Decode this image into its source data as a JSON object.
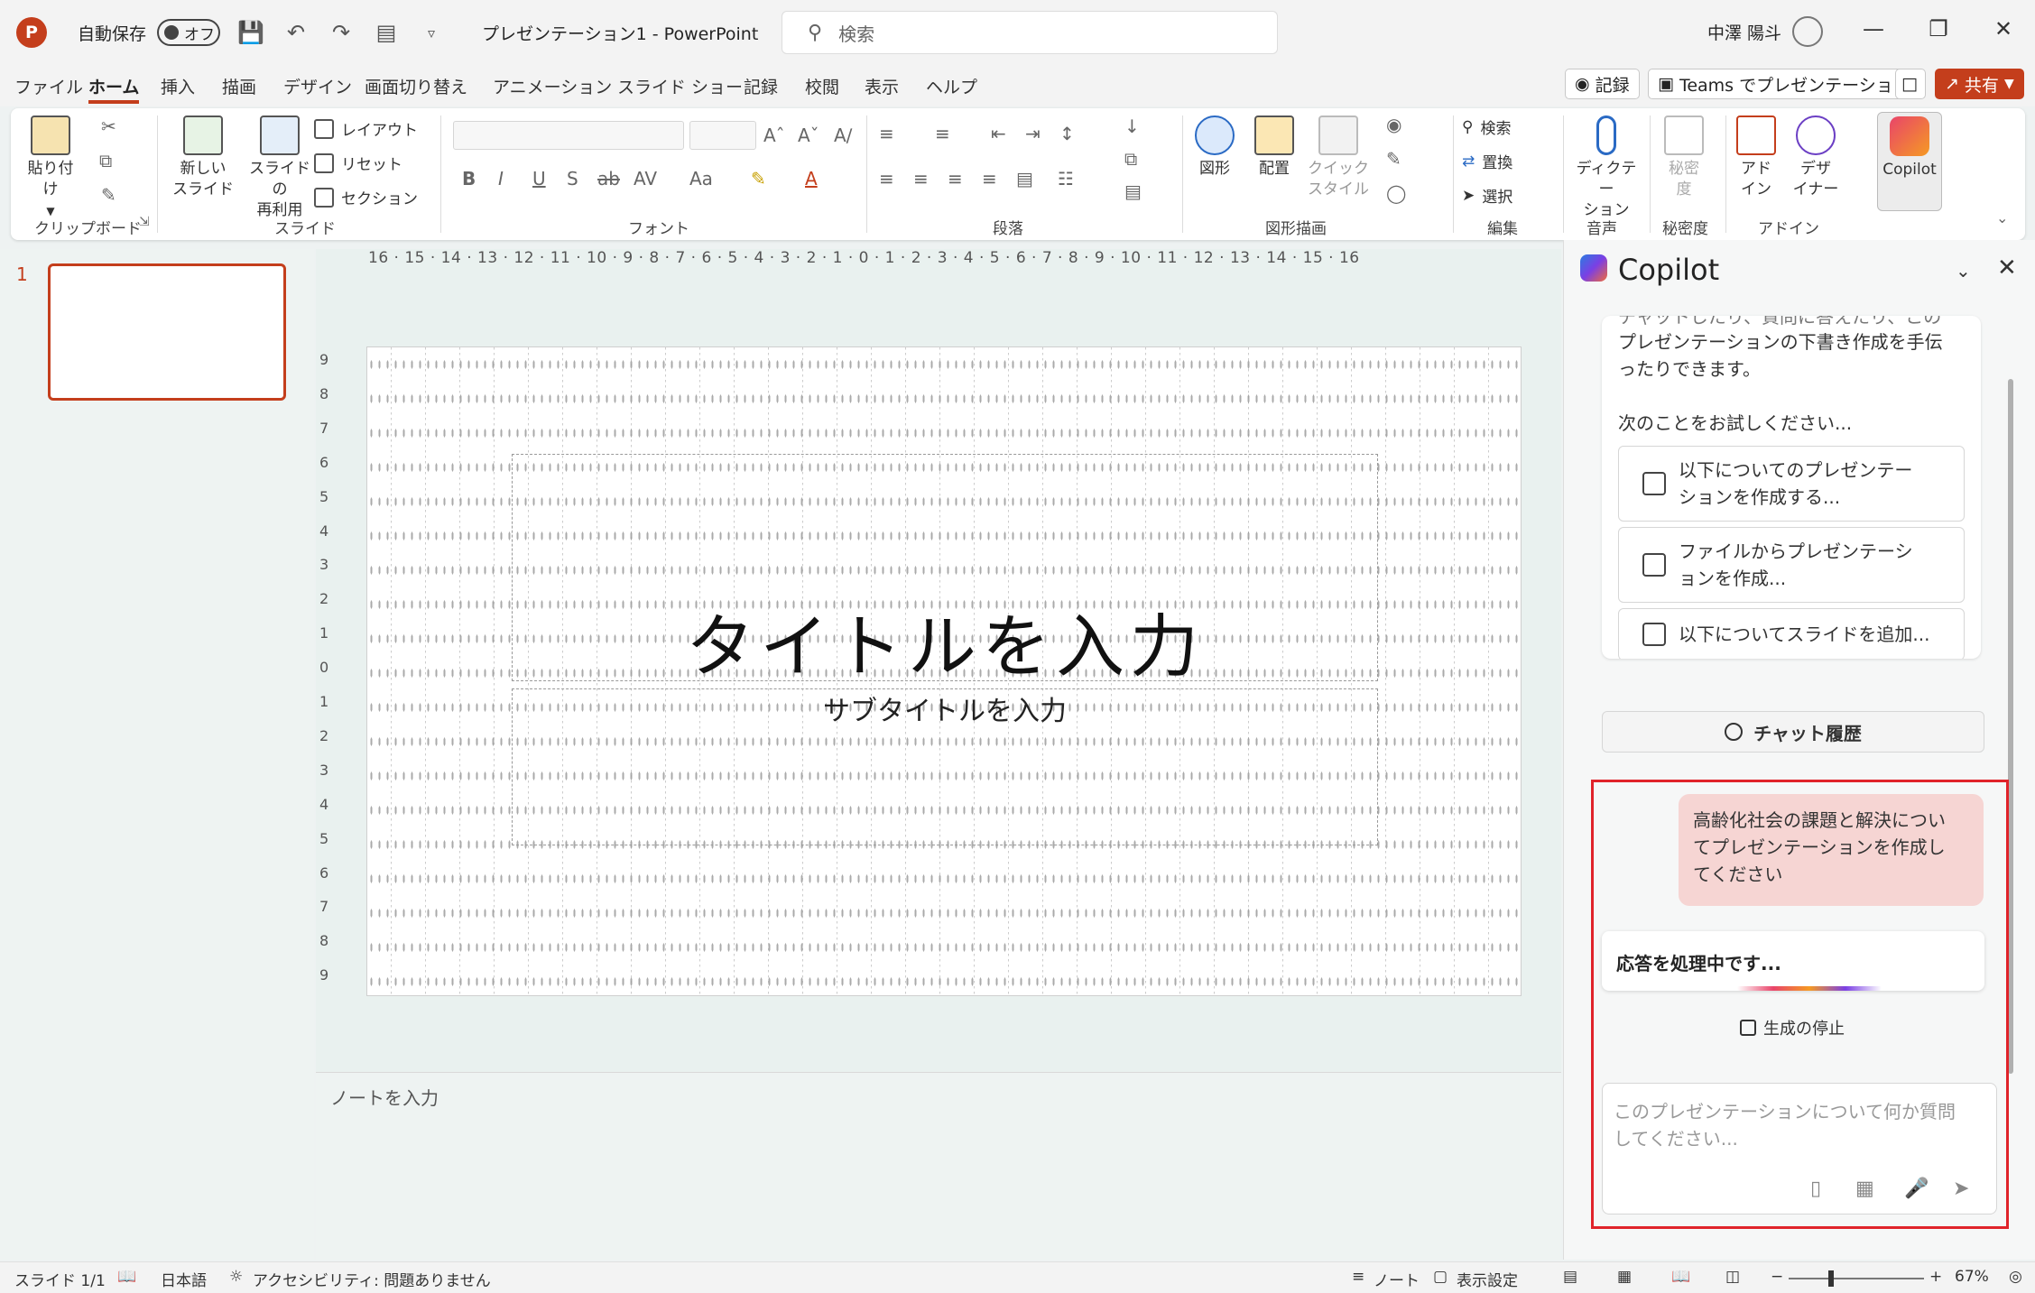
{
  "titlebar": {
    "logo": "P",
    "autosave_label": "自動保存",
    "autosave_state": "オフ",
    "doc_title": "プレゼンテーション1  -  PowerPoint",
    "search_placeholder": "検索",
    "user_name": "中澤 陽斗",
    "icons": [
      "powerpoint-logo-icon",
      "save-icon",
      "undo-icon",
      "redo-icon",
      "present-icon",
      "customize-icon",
      "search-icon",
      "avatar",
      "minimize-icon",
      "restore-icon",
      "close-icon"
    ]
  },
  "menu": {
    "items": [
      "ファイル",
      "ホーム",
      "挿入",
      "描画",
      "デザイン",
      "画面切り替え",
      "アニメーション",
      "スライド ショー",
      "記録",
      "校閲",
      "表示",
      "ヘルプ"
    ],
    "active": "ホーム",
    "record_label": "記録",
    "teams_label": "Teams でプレゼンテーション",
    "share_label": "共有"
  },
  "ribbon": {
    "paste": "貼り付け",
    "new_slide_1": "新しい",
    "new_slide_2": "スライド",
    "reuse_1": "スライドの",
    "reuse_2": "再利用",
    "layout": "レイアウト",
    "reset": "リセット",
    "section": "セクション",
    "shapes": "図形",
    "arrange": "配置",
    "quick_style_1": "クイック",
    "quick_style_2": "スタイル",
    "find": "検索",
    "replace": "置換",
    "select": "選択",
    "dictate_1": "ディクテー",
    "dictate_2": "ション",
    "sensitivity_1": "秘密",
    "sensitivity_2": "度",
    "addins_1": "アド",
    "addins_2": "イン",
    "designer_1": "デザ",
    "designer_2": "イナー",
    "copilot": "Copilot",
    "groups": {
      "clipboard": "クリップボード",
      "slides": "スライド",
      "font": "フォント",
      "paragraph": "段落",
      "drawing": "図形描画",
      "editing": "編集",
      "voice": "音声",
      "sensitivity": "秘密度",
      "addins": "アドイン"
    }
  },
  "thumbs": {
    "number": "1"
  },
  "ruler": {
    "horizontal": "16 · 15 · 14 · 13 · 12 · 11 · 10 · 9 · 8 · 7 · 6 · 5 · 4 · 3 · 2 · 1 · 0 · 1 · 2 · 3 · 4 · 5 · 6 · 7 · 8 · 9 · 10 · 11 · 12 · 13 · 14 · 15 · 16",
    "vertical": [
      "9",
      "8",
      "7",
      "6",
      "5",
      "4",
      "3",
      "2",
      "1",
      "0",
      "1",
      "2",
      "3",
      "4",
      "5",
      "6",
      "7",
      "8",
      "9"
    ]
  },
  "slide": {
    "title_placeholder": "タイトルを入力",
    "subtitle_placeholder": "サブタイトルを入力"
  },
  "notes": {
    "placeholder": "ノートを入力"
  },
  "copilot": {
    "title": "Copilot",
    "intro_clipped": "チャットしたり、質問に答えたり、この",
    "intro_line1": "プレゼンテーションの下書き作成を手伝",
    "intro_line2": "ったりできます。",
    "try_label": "次のことをお試しください...",
    "suggestions": [
      {
        "l1": "以下についてのプレゼンテー",
        "l2": "ションを作成する..."
      },
      {
        "l1": "ファイルからプレゼンテーシ",
        "l2": "ョンを作成..."
      },
      {
        "l1": "以下についてスライドを追加...",
        "l2": ""
      }
    ],
    "history_label": "チャット履歴",
    "user_msg_l1": "高齢化社会の課題と解決につい",
    "user_msg_l2": "てプレゼンテーションを作成し",
    "user_msg_l3": "てください",
    "processing": "応答を処理中です...",
    "stop_label": "生成の停止",
    "input_placeholder_l1": "このプレゼンテーションについて何か質問",
    "input_placeholder_l2": "してください..."
  },
  "status": {
    "slide_count": "スライド 1/1",
    "language": "日本語",
    "accessibility": "アクセシビリティ: 問題ありません",
    "notes_label": "ノート",
    "display_settings": "表示設定",
    "zoom_minus": "−",
    "zoom_plus": "+",
    "zoom": "67%"
  },
  "colors": {
    "accent": "#c43e1c",
    "highlight": "#e0232a",
    "user_bubble": "#f6d5d3"
  }
}
